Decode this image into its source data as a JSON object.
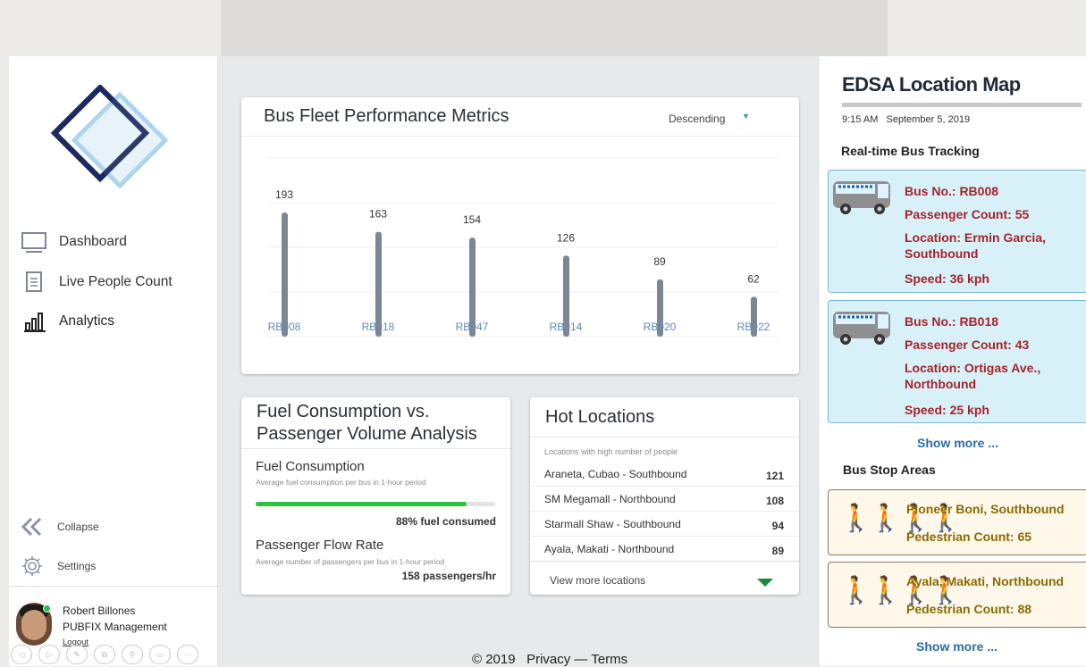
{
  "nav": {
    "items": [
      {
        "label": "Dashboard",
        "icon": "monitor-icon"
      },
      {
        "label": "Live People Count",
        "icon": "document-icon"
      },
      {
        "label": "Analytics",
        "icon": "bar-chart-icon"
      }
    ],
    "collapse_label": "Collapse",
    "settings_label": "Settings"
  },
  "user": {
    "name": "Robert Billones",
    "role": "PUBFIX Management",
    "logout_label": "Logout"
  },
  "performance": {
    "title": "Bus Fleet Performance Metrics",
    "sort_label": "Descending"
  },
  "chart_data": {
    "type": "bar",
    "categories": [
      "RB008",
      "RB018",
      "RB047",
      "RB014",
      "RB020",
      "RB022"
    ],
    "values": [
      193,
      163,
      154,
      126,
      89,
      62
    ],
    "ylim": [
      0,
      200
    ],
    "grid": true
  },
  "fuel": {
    "title": "Fuel Consumption vs. Passenger Volume Analysis",
    "consumption_label": "Fuel Consumption",
    "consumption_sub": "Average fuel consumption per bus in 1-hour period",
    "consumption_fraction": 0.88,
    "consumption_value": "88% fuel consumed",
    "flow_label": "Passenger Flow Rate",
    "flow_sub": "Average number of passengers per bus in 1-hour period",
    "flow_value": "158 passengers/hr"
  },
  "hot": {
    "title": "Hot Locations",
    "subtitle": "Locations with high number of people",
    "rows": [
      {
        "name": "Araneta, Cubao - Southbound",
        "count": "121"
      },
      {
        "name": "SM Megamall - Northbound",
        "count": "108"
      },
      {
        "name": "Starmall Shaw - Southbound",
        "count": "94"
      },
      {
        "name": "Ayala, Makati - Northbound",
        "count": "89"
      }
    ],
    "more_label": "View more locations"
  },
  "footer": {
    "text": "© 2019   Privacy — Terms"
  },
  "map": {
    "title": "EDSA Location Map",
    "datetime": "9:15 AM   September 5, 2019",
    "tracking_heading": "Real-time Bus Tracking",
    "buses": [
      {
        "bus_no": "Bus No.: RB008",
        "passengers": "Passenger Count: 55",
        "location": "Location: Ermin Garcia, Southbound",
        "speed": "Speed: 36 kph"
      },
      {
        "bus_no": "Bus No.: RB018",
        "passengers": "Passenger Count: 43",
        "location": "Location: Ortigas Ave., Northbound",
        "speed": "Speed: 25 kph"
      }
    ],
    "show_more": "Show more ...",
    "stops_heading": "Bus Stop Areas",
    "stops": [
      {
        "name": "Pioneer Boni, Southbound",
        "count": "Pedestrian Count: 65"
      },
      {
        "name": "Ayala, Makati, Northbound",
        "count": "Pedestrian Count: 88"
      }
    ],
    "stops_more": "Show more ..."
  },
  "colors": {
    "bar": "#7d8794",
    "progress": "#27c63a",
    "bus_text": "#a3242b",
    "stop_text": "#8c6a00",
    "link": "#2a6ea8"
  }
}
